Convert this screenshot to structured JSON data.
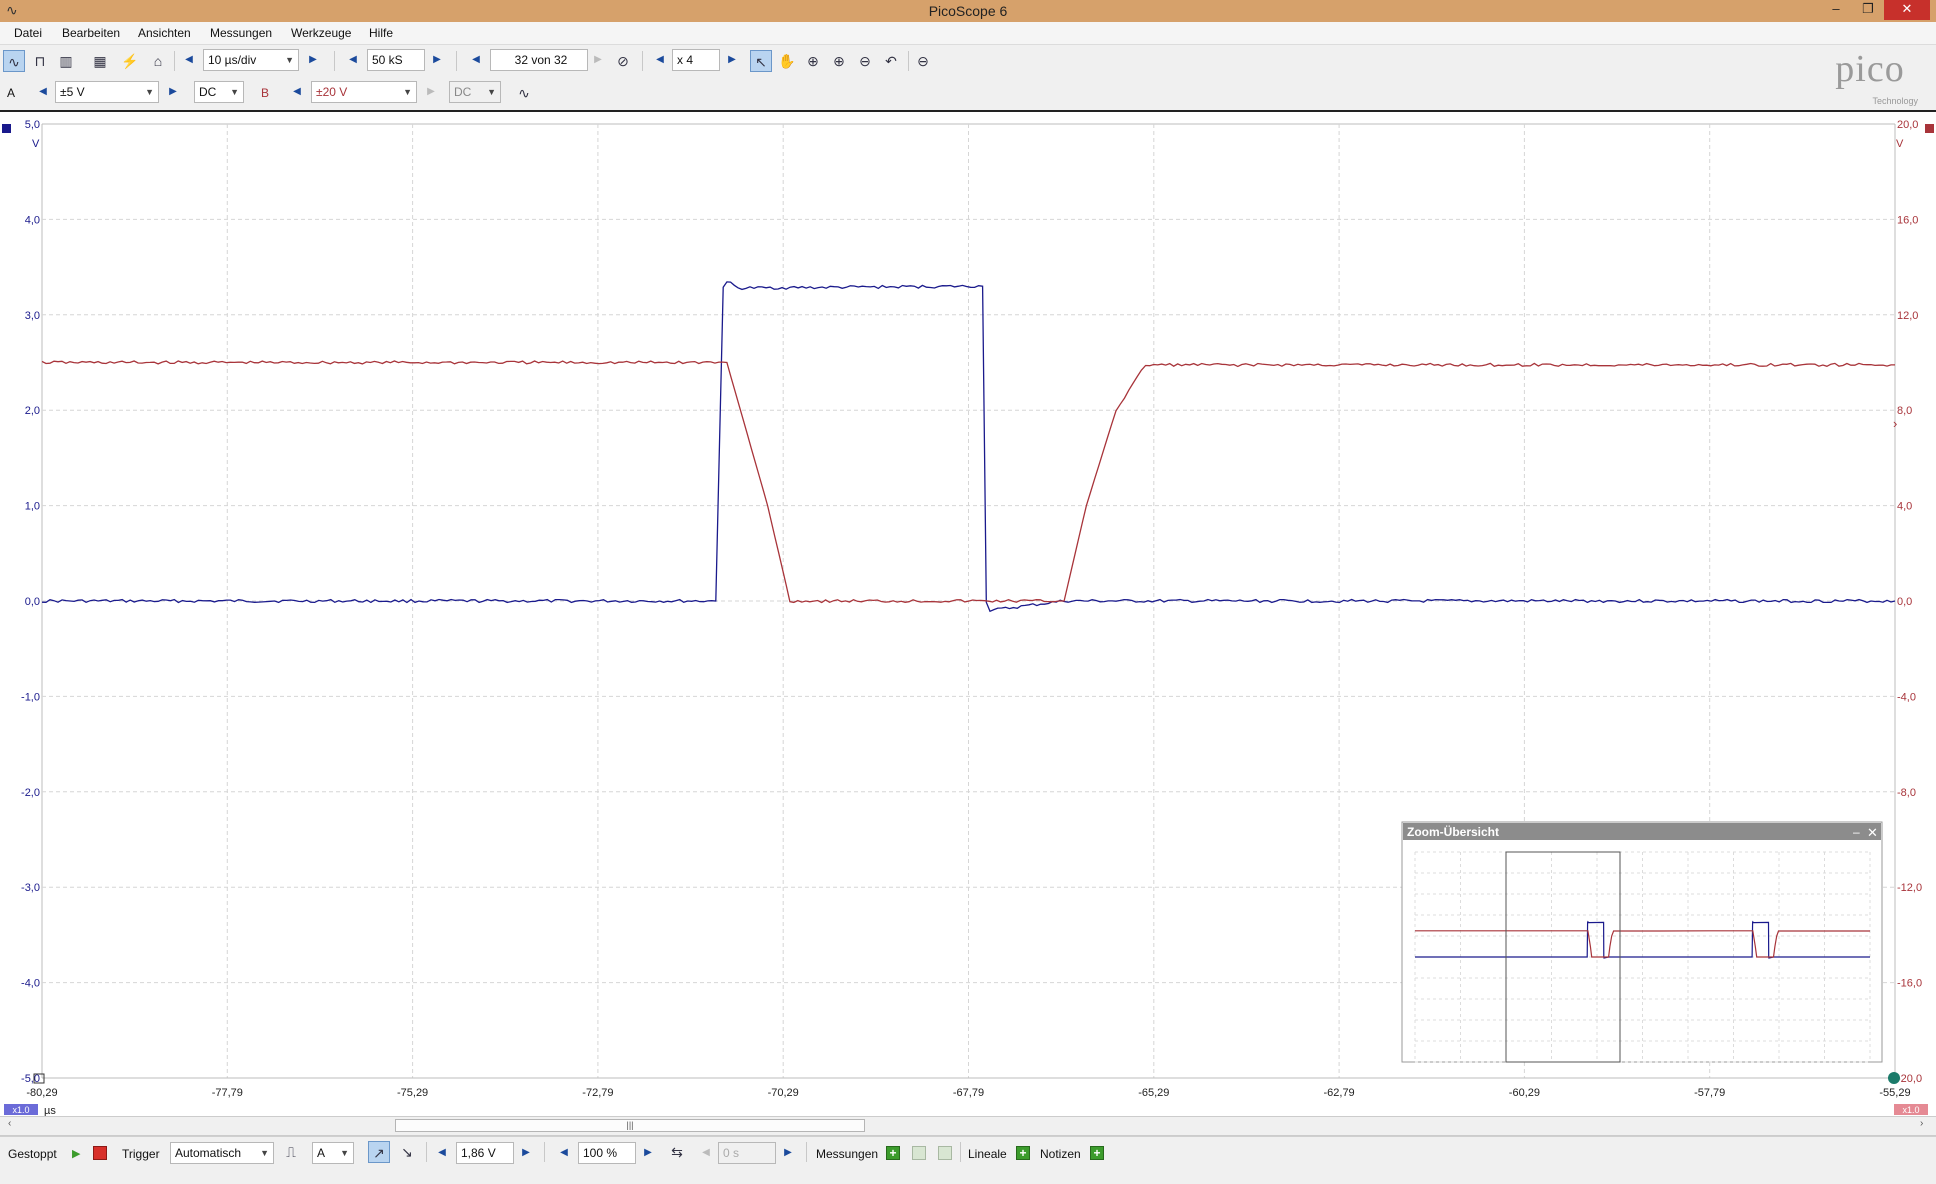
{
  "window": {
    "title": "PicoScope 6"
  },
  "menu": [
    "Datei",
    "Bearbeiten",
    "Ansichten",
    "Messungen",
    "Werkzeuge",
    "Hilfe"
  ],
  "toolbar": {
    "timebase": "10 µs/div",
    "samples": "50 kS",
    "buffer": "32 von 32",
    "zoom": "x 4"
  },
  "channels": {
    "a": {
      "label": "A",
      "range": "±5 V",
      "coupling": "DC",
      "color": "#1a1a8c"
    },
    "b": {
      "label": "B",
      "range": "±20 V",
      "coupling": "DC",
      "color": "#a8343a"
    }
  },
  "logo": {
    "name": "pico",
    "sub": "Technology"
  },
  "axes": {
    "left_unit": "V",
    "right_unit": "V",
    "x_unit": "µs",
    "left_scale_badge": "x1.0",
    "right_scale_badge": "x1.0",
    "left_ticks": [
      "5,0",
      "4,0",
      "3,0",
      "2,0",
      "1,0",
      "0,0",
      "-1,0",
      "-2,0",
      "-3,0",
      "-4,0",
      "-5,0"
    ],
    "right_ticks": [
      "20,0",
      "16,0",
      "12,0",
      "8,0",
      "4,0",
      "0,0",
      "-4,0",
      "-8,0",
      "-12,0",
      "-16,0",
      "-20,0"
    ],
    "x_ticks": [
      "-80,29",
      "-77,79",
      "-75,29",
      "-72,79",
      "-70,29",
      "-67,79",
      "-65,29",
      "-62,79",
      "-60,29",
      "-57,79",
      "-55,29"
    ]
  },
  "chart_data": {
    "type": "line",
    "x_range": [
      -80.29,
      -55.29
    ],
    "left_ylim": [
      -5,
      5
    ],
    "right_ylim": [
      -20,
      20
    ],
    "grid": true,
    "series": [
      {
        "name": "A",
        "axis": "left",
        "color": "#1a1a8c",
        "x": [
          -80.29,
          -71.2,
          -71.1,
          -71.05,
          -70.9,
          -67.6,
          -67.55,
          -67.5,
          -66.5,
          -55.29
        ],
        "y": [
          0.0,
          0.0,
          3.3,
          3.35,
          3.28,
          3.3,
          0.0,
          -0.1,
          0.0,
          0.0
        ]
      },
      {
        "name": "B",
        "axis": "right",
        "color": "#a8343a",
        "x": [
          -80.29,
          -71.05,
          -70.5,
          -70.2,
          -66.5,
          -66.2,
          -65.8,
          -65.4,
          -55.29
        ],
        "y": [
          10.0,
          10.0,
          4.0,
          0.0,
          0.0,
          4.0,
          8.0,
          9.9,
          9.9
        ]
      }
    ]
  },
  "zoom_overview": {
    "title": "Zoom-Übersicht"
  },
  "status": {
    "run_state": "Gestoppt",
    "trigger_label": "Trigger",
    "trigger_mode": "Automatisch",
    "trigger_source": "A",
    "trigger_level": "1,86 V",
    "pretrigger": "100 %",
    "delay": "0 s",
    "measurements": "Messungen",
    "rulers": "Lineale",
    "notes": "Notizen"
  }
}
